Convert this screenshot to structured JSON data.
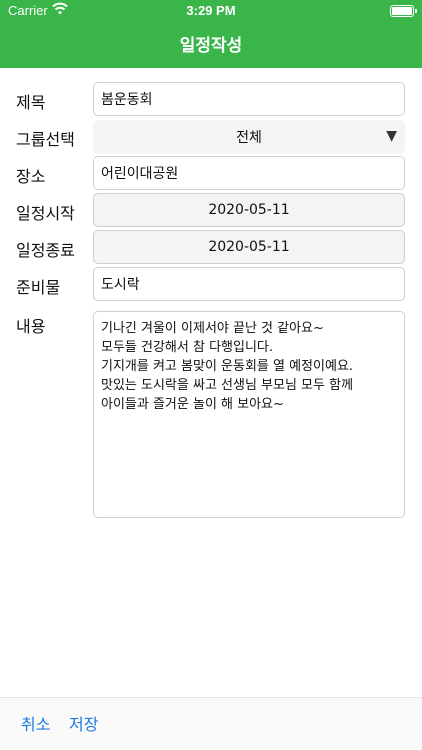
{
  "status": {
    "carrier": "Carrier",
    "time": "3:29 PM"
  },
  "nav": {
    "title": "일정작성"
  },
  "form": {
    "title_label": "제목",
    "title_value": "봄운동회",
    "group_label": "그룹선택",
    "group_value": "전체",
    "place_label": "장소",
    "place_value": "어린이대공원",
    "start_label": "일정시작",
    "start_value": "2020-05-11",
    "end_label": "일정종료",
    "end_value": "2020-05-11",
    "prep_label": "준비물",
    "prep_value": "도시락",
    "content_label": "내용",
    "content_value": "기나긴 겨울이 이제서야 끝난 것 같아요~\n모두들 건강해서 참 다행입니다.\n기지개를 켜고 봄맞이 운동회를 열 예정이예요.\n맛있는 도시락을 싸고 선생님 부모님 모두 함께\n아이들과 즐거운 놀이 해 보아요~"
  },
  "bottom": {
    "cancel_label": "취소",
    "save_label": "저장"
  },
  "colors": {
    "accent": "#3ab54a",
    "link": "#1f7ae6"
  }
}
